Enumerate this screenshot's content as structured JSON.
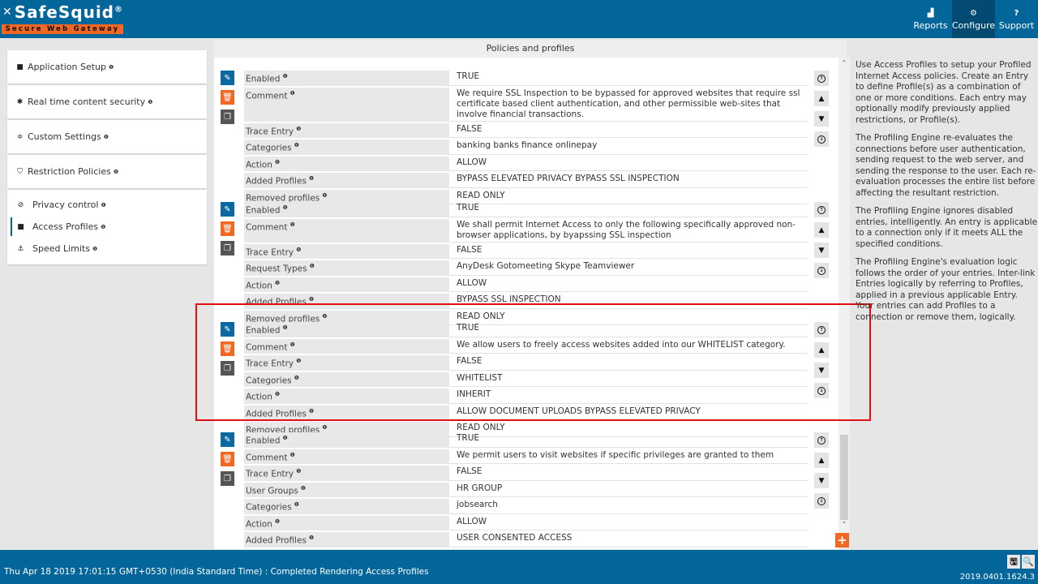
{
  "header": {
    "logo_name": "SafeSquid",
    "logo_reg": "®",
    "logo_tagline": "Secure Web Gateway",
    "nav": [
      {
        "label": "Reports",
        "icon": "chart-icon",
        "glyph": "▟"
      },
      {
        "label": "Configure",
        "icon": "cogs-icon",
        "glyph": "⚙",
        "active": true
      },
      {
        "label": "Support",
        "icon": "question-icon",
        "glyph": "?"
      }
    ]
  },
  "sidebar": {
    "cards": [
      {
        "label": "Application Setup",
        "icon": "briefcase-icon",
        "glyph": "■"
      },
      {
        "label": "Real time content security",
        "icon": "bug-icon",
        "glyph": "✱"
      },
      {
        "label": "Custom Settings",
        "icon": "sliders-icon",
        "glyph": "≑"
      },
      {
        "label": "Restriction Policies",
        "icon": "shield-icon",
        "glyph": "⛉"
      }
    ],
    "sub_items": [
      {
        "label": "Privacy control",
        "icon": "ban-icon",
        "glyph": "⊘"
      },
      {
        "label": "Access Profiles",
        "icon": "briefcase-icon",
        "glyph": "■",
        "active": true
      },
      {
        "label": "Speed Limits",
        "icon": "anchor-icon",
        "glyph": "⚓"
      }
    ],
    "info_glyph": "❶"
  },
  "main": {
    "title": "Policies and profiles",
    "entries": [
      {
        "rows": [
          {
            "key": "Enabled",
            "value": "TRUE"
          },
          {
            "key": "Comment",
            "value": "We require SSL Inspection to be bypassed for approved websites that require ssl certificate based client authentication, and other permissible web-sites that involve financial transactions."
          },
          {
            "key": "Trace Entry",
            "value": "FALSE"
          },
          {
            "key": "Categories",
            "value": "banking  banks  finance  onlinepay"
          },
          {
            "key": "Action",
            "value": "ALLOW"
          },
          {
            "key": "Added Profiles",
            "value": "BYPASS ELEVATED PRIVACY  BYPASS SSL INSPECTION"
          },
          {
            "key": "Removed profiles",
            "value": "READ ONLY"
          }
        ]
      },
      {
        "rows": [
          {
            "key": "Enabled",
            "value": "TRUE"
          },
          {
            "key": "Comment",
            "value": "We shall permit Internet Access to only the following specifically approved non-browser applications, by byapssing SSL inspection"
          },
          {
            "key": "Trace Entry",
            "value": "FALSE"
          },
          {
            "key": "Request Types",
            "value": "AnyDesk  Gotomeeting  Skype  Teamviewer"
          },
          {
            "key": "Action",
            "value": "ALLOW"
          },
          {
            "key": "Added Profiles",
            "value": "BYPASS SSL INSPECTION"
          },
          {
            "key": "Removed profiles",
            "value": "READ ONLY"
          }
        ]
      },
      {
        "highlighted": true,
        "rows": [
          {
            "key": "Enabled",
            "value": "TRUE"
          },
          {
            "key": "Comment",
            "value": "We allow users to freely access websites added into our WHITELIST category."
          },
          {
            "key": "Trace Entry",
            "value": "FALSE"
          },
          {
            "key": "Categories",
            "value": "WHITELIST"
          },
          {
            "key": "Action",
            "value": "INHERIT"
          },
          {
            "key": "Added Profiles",
            "value": "ALLOW DOCUMENT UPLOADS  BYPASS ELEVATED PRIVACY"
          },
          {
            "key": "Removed profiles",
            "value": "READ ONLY"
          }
        ]
      },
      {
        "rows": [
          {
            "key": "Enabled",
            "value": "TRUE"
          },
          {
            "key": "Comment",
            "value": "We permit users to visit websites if specific privileges are granted to them"
          },
          {
            "key": "Trace Entry",
            "value": "FALSE"
          },
          {
            "key": "User Groups",
            "value": "HR GROUP"
          },
          {
            "key": "Categories",
            "value": "jobsearch"
          },
          {
            "key": "Action",
            "value": "ALLOW"
          },
          {
            "key": "Added Profiles",
            "value": "USER CONSENTED ACCESS"
          }
        ]
      }
    ],
    "actions": {
      "edit": "✎",
      "delete": "🗑",
      "copy": "❐"
    },
    "move": {
      "top": "↑",
      "up": "▲",
      "down": "▼",
      "bottom": "↓"
    },
    "add_label": "+"
  },
  "help": {
    "paragraphs": [
      "Use Access Profiles to setup your Profiled Internet Access policies. Create an Entry to define Profile(s) as a combination of one or more conditions. Each entry may optionally modify previously applied restrictions, or Profile(s).",
      "The Profiling Engine re-evaluates the connections before user authentication, sending request to the web server, and sending the response to the user. Each re-evaluation processes the entire list before affecting the resultant restriction.",
      "The Profiling Engine ignores disabled entries, intelligently. An entry is applicable to a connection only if it meets ALL the specified conditions.",
      "The Profiling Engine's evaluation logic follows the order of your entries. Inter-link Entries logically by referring to Profiles, applied in a previous applicable Entry. Your entries can add Profiles to a connection or remove them, logically."
    ]
  },
  "footer": {
    "status": "Thu Apr 18 2019 17:01:15 GMT+0530 (India Standard Time) : Completed Rendering Access Profiles",
    "version": "2019.0401.1624.3",
    "save_glyph": "🖫",
    "search_glyph": "🔍"
  },
  "colors": {
    "brand_blue": "#03669b",
    "brand_orange": "#f26722",
    "highlight_red": "#e01010"
  }
}
